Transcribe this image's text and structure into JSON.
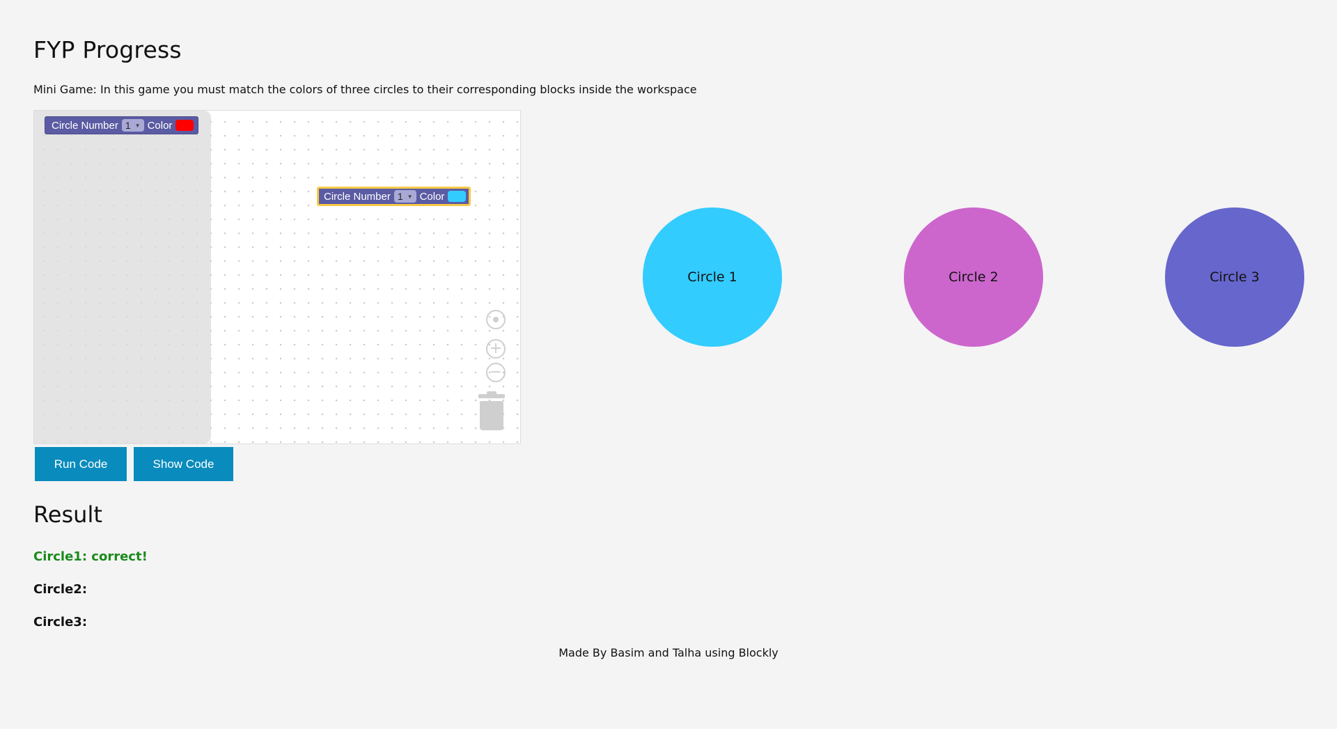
{
  "page": {
    "title": "FYP Progress",
    "intro": "Mini Game: In this game you must match the colors of three circles to their corresponding blocks inside the workspace"
  },
  "blockly": {
    "toolbox_block": {
      "label": "Circle Number",
      "number": "1",
      "color_label": "Color",
      "swatch_color": "#ff0000"
    },
    "workspace_block": {
      "label": "Circle Number",
      "number": "1",
      "color_label": "Color",
      "swatch_color": "#33ccff"
    },
    "controls": {
      "zoom_in": "+",
      "zoom_out": "−"
    }
  },
  "buttons": {
    "run": "Run Code",
    "show": "Show Code"
  },
  "circles": [
    {
      "label": "Circle 1",
      "color": "#33ccff"
    },
    {
      "label": "Circle 2",
      "color": "#cc66cc"
    },
    {
      "label": "Circle 3",
      "color": "#6666cc"
    }
  ],
  "result": {
    "title": "Result",
    "lines": [
      {
        "text": "Circle1: correct!",
        "color": "#1a8a1a"
      },
      {
        "text": "Circle2:",
        "color": "#111111"
      },
      {
        "text": "Circle3:",
        "color": "#111111"
      }
    ]
  },
  "footer": "Made By Basim and Talha using Blockly",
  "colors": {
    "background": "#f4f4f5",
    "button": "#0a8bbd",
    "block": "#5b5ba3",
    "selected_outline": "#f7c948"
  }
}
